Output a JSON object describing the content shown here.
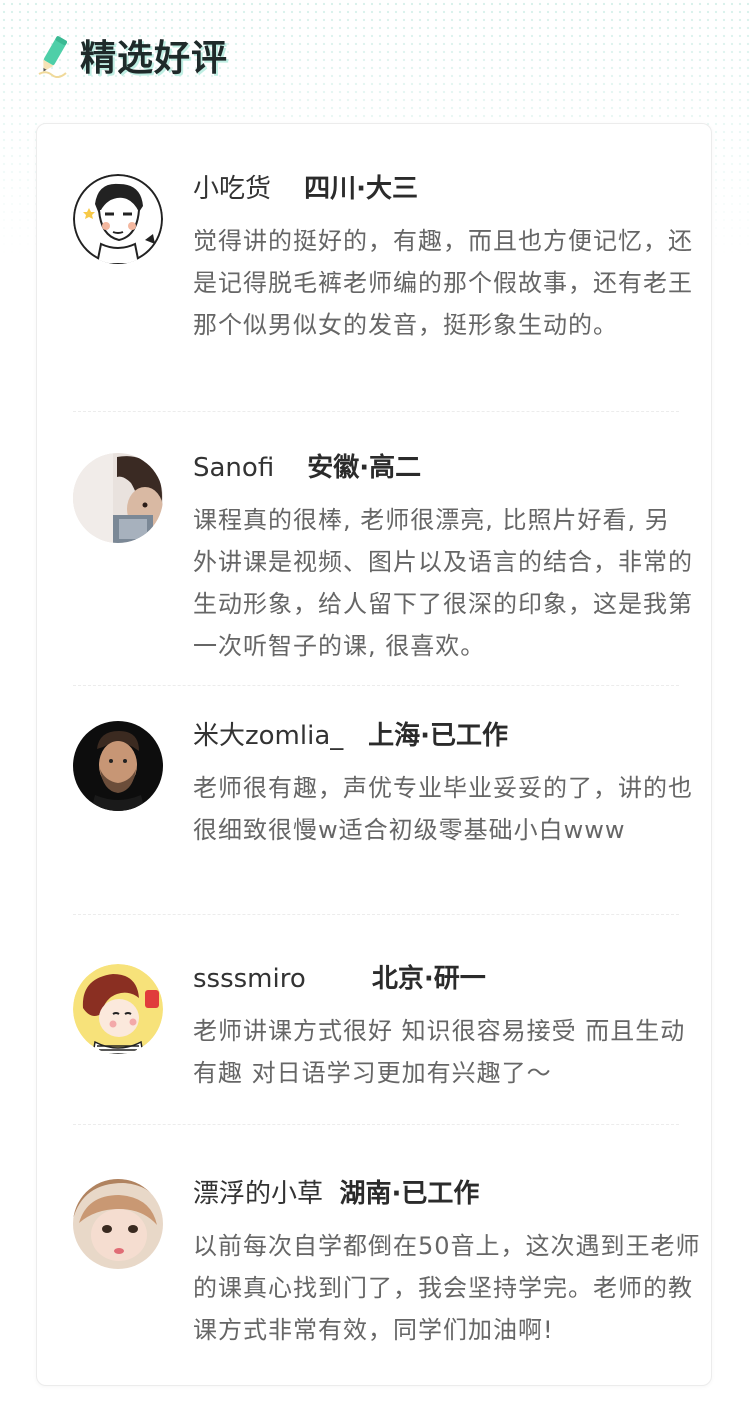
{
  "section": {
    "title": "精选好评",
    "icon": "pencil-icon",
    "accent": "#4ecfa8"
  },
  "reviews": [
    {
      "name": "小吃货",
      "location": "四川·大三",
      "text": "觉得讲的挺好的，有趣，而且也方便记忆，还是记得脱毛裤老师编的那个假故事，还有老王那个似男似女的发音，挺形象生动的。",
      "avatar": "cartoon-boy-avatar"
    },
    {
      "name": "Sanofi",
      "location": "安徽·高二",
      "text": "课程真的很棒, 老师很漂亮, 比照片好看, 另外讲课是视频、图片以及语言的结合，非常的生动形象，给人留下了很深的印象，这是我第一次听智子的课, 很喜欢。",
      "avatar": "photo-avatar"
    },
    {
      "name": "米大zomlia_",
      "location": "上海·已工作",
      "text": "老师很有趣，声优专业毕业妥妥的了，讲的也很细致很慢w适合初级零基础小白www",
      "avatar": "portrait-avatar"
    },
    {
      "name": "ssssmiro",
      "location": "北京·研一",
      "text": "老师讲课方式很好 知识很容易接受 而且生动有趣 对日语学习更加有兴趣了～",
      "avatar": "cartoon-kid-avatar"
    },
    {
      "name": "漂浮的小草",
      "location": "湖南·已工作",
      "text": "以前每次自学都倒在50音上，这次遇到王老师的课真心找到门了，我会坚持学完。老师的教课方式非常有效，同学们加油啊!",
      "avatar": "girl-photo-avatar"
    }
  ]
}
